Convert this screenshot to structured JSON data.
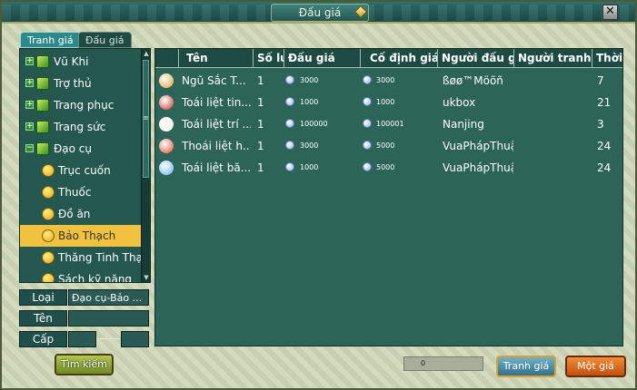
{
  "window": {
    "title": "Đấu giá",
    "close_glyph": "✕"
  },
  "tabs": [
    {
      "label": "Tranh giá",
      "active": true
    },
    {
      "label": "Đấu giá",
      "active": false
    }
  ],
  "categories": [
    {
      "label": "Vũ Khi",
      "expander": "+",
      "icon": "book-icon"
    },
    {
      "label": "Trợ thủ",
      "expander": "+",
      "icon": "book-icon"
    },
    {
      "label": "Trang phục",
      "expander": "+",
      "icon": "book-icon"
    },
    {
      "label": "Trang sức",
      "expander": "+",
      "icon": "book-icon"
    },
    {
      "label": "Đạo cụ",
      "expander": "−",
      "icon": "book-icon"
    }
  ],
  "subcategories": [
    {
      "label": "Trục cuốn",
      "selected": false
    },
    {
      "label": "Thuốc",
      "selected": false
    },
    {
      "label": "Đồ ăn",
      "selected": false
    },
    {
      "label": "Bảo Thạch",
      "selected": true
    },
    {
      "label": "Thăng Tinh Thạch",
      "selected": false
    },
    {
      "label": "Sách kỹ năng",
      "selected": false
    }
  ],
  "filters": {
    "type_label": "Loại",
    "type_value": "Đạo cụ-Bảo ...",
    "name_label": "Tên",
    "name_value": "",
    "level_label": "Cấp",
    "level_min": "",
    "level_max": ""
  },
  "table": {
    "headers": [
      "Tên",
      "Số lư",
      "Đấu giá",
      "Cố định giá",
      "Người đấu g",
      "Người tranh",
      "Thời"
    ],
    "rows": [
      {
        "icon": "rainbow-gem-icon",
        "icon_color": "#e0a030",
        "name": "Ngũ Sắc T...",
        "qty": "1",
        "bid": "3000",
        "fixed": "3000",
        "seller": "ßøø™Möõñ",
        "bidder": "",
        "time": "7"
      },
      {
        "icon": "red-gem-icon",
        "icon_color": "#c8302a",
        "name": "Toái liệt tin...",
        "qty": "1",
        "bid": "1000",
        "fixed": "1000",
        "seller": "ukbox",
        "bidder": "",
        "time": "21"
      },
      {
        "icon": "white-gem-icon",
        "icon_color": "#f4efe0",
        "name": "Toái liệt trí ...",
        "qty": "1",
        "bid": "100000",
        "fixed": "100001",
        "seller": "Nanjing",
        "bidder": "",
        "time": "3"
      },
      {
        "icon": "fire-gem-icon",
        "icon_color": "#e04830",
        "name": "Thoái liệt h...",
        "qty": "1",
        "bid": "3000",
        "fixed": "5000",
        "seller": "VuaPhápThuậ",
        "bidder": "",
        "time": "24"
      },
      {
        "icon": "ice-gem-icon",
        "icon_color": "#6ab0f0",
        "name": "Toái liệt bă...",
        "qty": "1",
        "bid": "1000",
        "fixed": "5000",
        "seller": "VuaPhápThuậ",
        "bidder": "",
        "time": "24"
      }
    ]
  },
  "footer": {
    "search_label": "Tìm kiếm",
    "balance": "0",
    "bid_label": "Tranh giá",
    "buy_label": "Một giá"
  },
  "colors": {
    "accent": "#2d8a8a",
    "selected_row": "#f0c23d",
    "panel": "#2c6458"
  }
}
